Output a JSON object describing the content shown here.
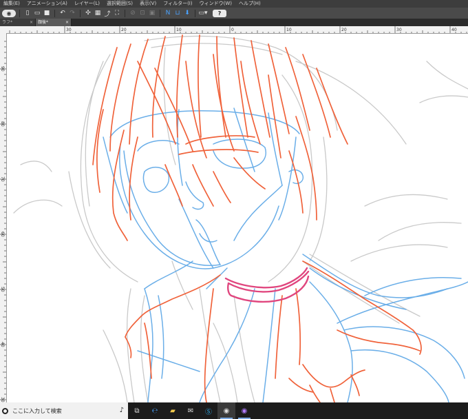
{
  "menu": [
    "編集(E)",
    "アニメーション(A)",
    "レイヤー(L)",
    "選択範囲(S)",
    "表示(V)",
    "フィルター(I)",
    "ウィンドウ(W)",
    "ヘルプ(H)"
  ],
  "tabs": [
    {
      "label": "ラフ*",
      "close": "×"
    },
    {
      "label": "顔後*",
      "close": "×"
    }
  ],
  "ruler_top_labels": [
    "30",
    "20",
    "10",
    "0",
    "10",
    "20",
    "30",
    "40"
  ],
  "ruler_left_labels": [
    "90",
    "80",
    "70",
    "60",
    "50",
    "40",
    "30"
  ],
  "taskbar": {
    "search_placeholder": "ここに入力して検索",
    "apps": [
      "task-view",
      "edge",
      "file-explorer",
      "mail",
      "skype",
      "clip-studio",
      "eye-app"
    ]
  },
  "colors": {
    "menubar": "#3d3d3d",
    "toolbar": "#4a4a4a",
    "sketch_red": "#f0623a",
    "sketch_blue": "#6aaee8",
    "sketch_gray": "#c9c9c9",
    "choker": "#e0467e"
  }
}
